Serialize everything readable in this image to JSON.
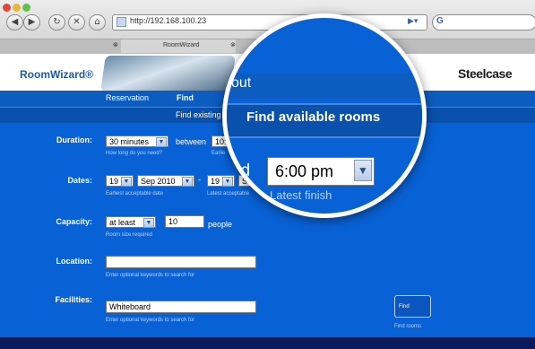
{
  "browser": {
    "url": "http://192.168.100.23",
    "tabs": [
      "RoomWizard"
    ],
    "search_placeholder": "G"
  },
  "header": {
    "logo": "RoomWizard®",
    "brand": "Steelcase"
  },
  "nav": {
    "items": [
      "Reservation",
      "Find"
    ],
    "subitem": "Find existing"
  },
  "form": {
    "duration": {
      "label": "Duration:",
      "value": "30 minutes",
      "between": "between",
      "start_value": "10:",
      "hint": "How long do you need?",
      "hint2": "Earlie"
    },
    "dates": {
      "label": "Dates:",
      "day1": "19",
      "month1": "Sep 2010",
      "sep": "-",
      "day2": "19",
      "month2": "Se",
      "hint1": "Earliest acceptable date",
      "hint2": "Latest acceptable"
    },
    "capacity": {
      "label": "Capacity:",
      "qualifier": "at least",
      "value": "10",
      "unit": "people",
      "hint": "Room size required"
    },
    "location": {
      "label": "Location:",
      "value": "",
      "hint": "Enter optional keywords to search for"
    },
    "facilities": {
      "label": "Facilities:",
      "value": "Whiteboard",
      "hint": "Enter optional keywords to search for"
    },
    "find_button": "Find",
    "find_caption": "Find rooms"
  },
  "magnifier": {
    "top_text": "out",
    "heading": "Find available rooms",
    "and_text": "nd",
    "time_value": "6:00 pm",
    "caption": "Latest finish"
  }
}
